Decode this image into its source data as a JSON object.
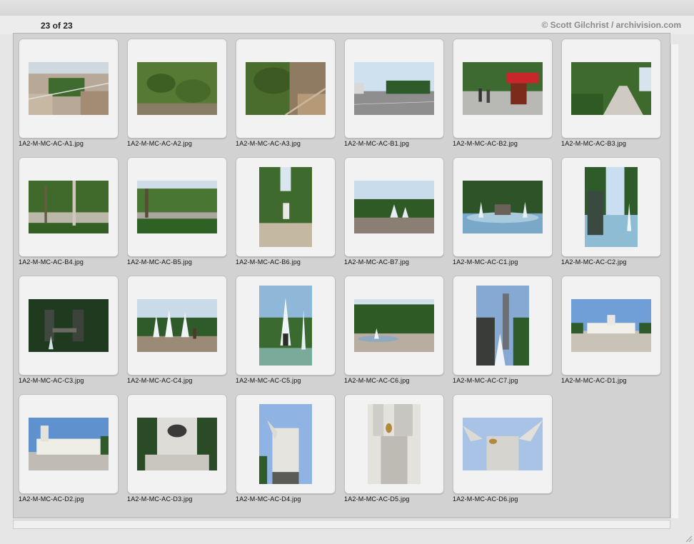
{
  "header": {
    "count": "23 of 23",
    "credit": "© Scott Gilchrist / archivision.com"
  },
  "items": [
    {
      "file": "1A2-M-MC-AC-A1.jpg",
      "orient": "land",
      "scene": "aerial-city"
    },
    {
      "file": "1A2-M-MC-AC-A2.jpg",
      "orient": "land",
      "scene": "aerial-park"
    },
    {
      "file": "1A2-M-MC-AC-A3.jpg",
      "orient": "land",
      "scene": "aerial-park2"
    },
    {
      "file": "1A2-M-MC-AC-B1.jpg",
      "orient": "land",
      "scene": "plaza"
    },
    {
      "file": "1A2-M-MC-AC-B2.jpg",
      "orient": "land",
      "scene": "street-kiosk"
    },
    {
      "file": "1A2-M-MC-AC-B3.jpg",
      "orient": "land",
      "scene": "tree-path"
    },
    {
      "file": "1A2-M-MC-AC-B4.jpg",
      "orient": "land",
      "scene": "park-lawn"
    },
    {
      "file": "1A2-M-MC-AC-B5.jpg",
      "orient": "land",
      "scene": "park-hedge"
    },
    {
      "file": "1A2-M-MC-AC-B6.jpg",
      "orient": "port",
      "scene": "park-walk"
    },
    {
      "file": "1A2-M-MC-AC-B7.jpg",
      "orient": "land",
      "scene": "fountain-trees"
    },
    {
      "file": "1A2-M-MC-AC-C1.jpg",
      "orient": "land",
      "scene": "fountain-pool"
    },
    {
      "file": "1A2-M-MC-AC-C2.jpg",
      "orient": "port",
      "scene": "fountain-statue"
    },
    {
      "file": "1A2-M-MC-AC-C3.jpg",
      "orient": "land",
      "scene": "statues-dark"
    },
    {
      "file": "1A2-M-MC-AC-C4.jpg",
      "orient": "land",
      "scene": "fountain-jets"
    },
    {
      "file": "1A2-M-MC-AC-C5.jpg",
      "orient": "port",
      "scene": "fountain-tall"
    },
    {
      "file": "1A2-M-MC-AC-C6.jpg",
      "orient": "land",
      "scene": "fountain-grove"
    },
    {
      "file": "1A2-M-MC-AC-C7.jpg",
      "orient": "port",
      "scene": "tower-fountain"
    },
    {
      "file": "1A2-M-MC-AC-D1.jpg",
      "orient": "land",
      "scene": "colonnade-wide"
    },
    {
      "file": "1A2-M-MC-AC-D2.jpg",
      "orient": "land",
      "scene": "colonnade-close"
    },
    {
      "file": "1A2-M-MC-AC-D3.jpg",
      "orient": "land",
      "scene": "monument-base"
    },
    {
      "file": "1A2-M-MC-AC-D4.jpg",
      "orient": "port",
      "scene": "angel-sculpture"
    },
    {
      "file": "1A2-M-MC-AC-D5.jpg",
      "orient": "port",
      "scene": "sculpture-group"
    },
    {
      "file": "1A2-M-MC-AC-D6.jpg",
      "orient": "land",
      "scene": "angels-sky"
    }
  ],
  "colors": {
    "panel": "#d2d2d2",
    "slide": "#f2f2f2",
    "credit": "#8a8a8a"
  }
}
